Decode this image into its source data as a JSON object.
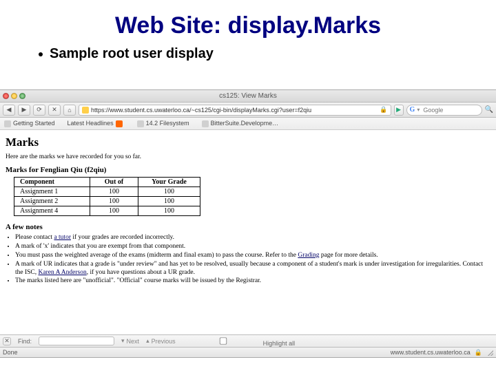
{
  "slide": {
    "title": "Web Site: display.Marks",
    "bullet": "Sample root user display"
  },
  "window": {
    "title": "cs125: View Marks"
  },
  "toolbar": {
    "back": "◀",
    "fwd": "▶",
    "reload": "⟳",
    "stop": "✕",
    "home": "⌂",
    "url": "https://www.student.cs.uwaterloo.ca/~cs125/cgi-bin/displayMarks.cgi?user=f2qiu",
    "go": "▶",
    "search_engine": "G",
    "search_placeholder": "Google",
    "mglass": "🔍"
  },
  "bookmarks": {
    "items": [
      {
        "label": "Getting Started"
      },
      {
        "label": "Latest Headlines"
      },
      {
        "label": "14.2 Filesystem"
      },
      {
        "label": "BitterSuite.Developme…"
      }
    ]
  },
  "page": {
    "h1": "Marks",
    "intro": "Here are the marks we have recorded for you so far.",
    "subhead": "Marks for Fenglian Qiu (f2qiu)",
    "table": {
      "headers": [
        "Component",
        "Out of",
        "Your Grade"
      ],
      "rows": [
        [
          "Assignment 1",
          "100",
          "100"
        ],
        [
          "Assignment 2",
          "100",
          "100"
        ],
        [
          "Assignment 4",
          "100",
          "100"
        ]
      ]
    },
    "notes_head": "A few notes",
    "notes": [
      {
        "pre": "Please contact ",
        "link": "a tutor",
        "post": " if your grades are recorded incorrectly."
      },
      {
        "pre": "A mark of 'x' indicates that you are exempt from that component.",
        "link": "",
        "post": ""
      },
      {
        "pre": "You must pass the weighted average of the exams (midterm and final exam) to pass the course. Refer to the ",
        "link": "Grading",
        "post": " page for more details."
      },
      {
        "pre": "A mark of UR indicates that a grade is \"under review\" and has yet to be resolved, usually because a component of a student's mark is under investigation for irregularities. Contact the ISC, ",
        "link": "Karen A Anderson",
        "post": ", if you have questions about a UR grade."
      },
      {
        "pre": "The marks listed here are \"unofficial\". \"Official\" course marks will be issued by the Registrar.",
        "link": "",
        "post": ""
      }
    ]
  },
  "findbar": {
    "label": "Find:",
    "next": "Next",
    "prev": "Previous",
    "highlight": "Highlight all"
  },
  "status": {
    "left": "Done",
    "right": "www.student.cs.uwaterloo.ca"
  }
}
